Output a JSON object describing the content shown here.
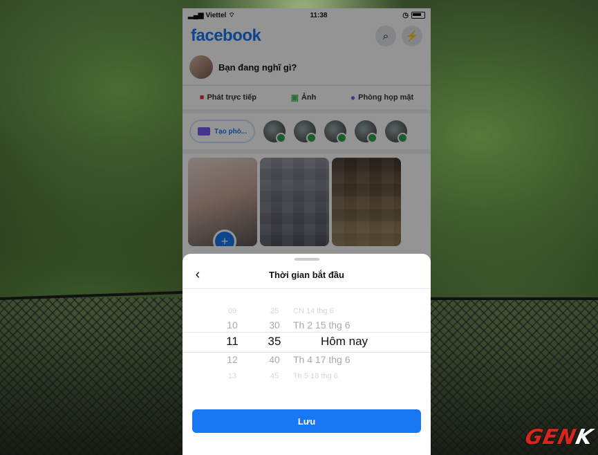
{
  "status_bar": {
    "carrier": "Viettel",
    "time": "11:38"
  },
  "header": {
    "logo": "facebook",
    "icons": [
      "search-icon",
      "messenger-icon"
    ]
  },
  "composer": {
    "prompt": "Bạn đang nghĩ gì?"
  },
  "actions": [
    {
      "label": "Phát trực tiếp",
      "icon": "live-video-icon"
    },
    {
      "label": "Ảnh",
      "icon": "photo-icon"
    },
    {
      "label": "Phòng họp mặt",
      "icon": "room-icon"
    }
  ],
  "rooms": {
    "create_label": "Tạo phò..."
  },
  "sheet": {
    "title": "Thời gian bắt đầu",
    "save_label": "Lưu",
    "picker": {
      "rows": [
        {
          "hour": "09",
          "minute": "25",
          "date": "CN 14 thg 6"
        },
        {
          "hour": "10",
          "minute": "30",
          "date": "Th 2 15 thg 6"
        },
        {
          "hour": "11",
          "minute": "35",
          "date": "Hôm nay"
        },
        {
          "hour": "12",
          "minute": "40",
          "date": "Th 4 17 thg 6"
        },
        {
          "hour": "13",
          "minute": "45",
          "date": "Th 5 18 thg 6"
        }
      ]
    }
  },
  "watermark": {
    "text_a": "GEN",
    "text_b": "K"
  },
  "colors": {
    "brand": "#1877f2",
    "online": "#31a24c"
  }
}
